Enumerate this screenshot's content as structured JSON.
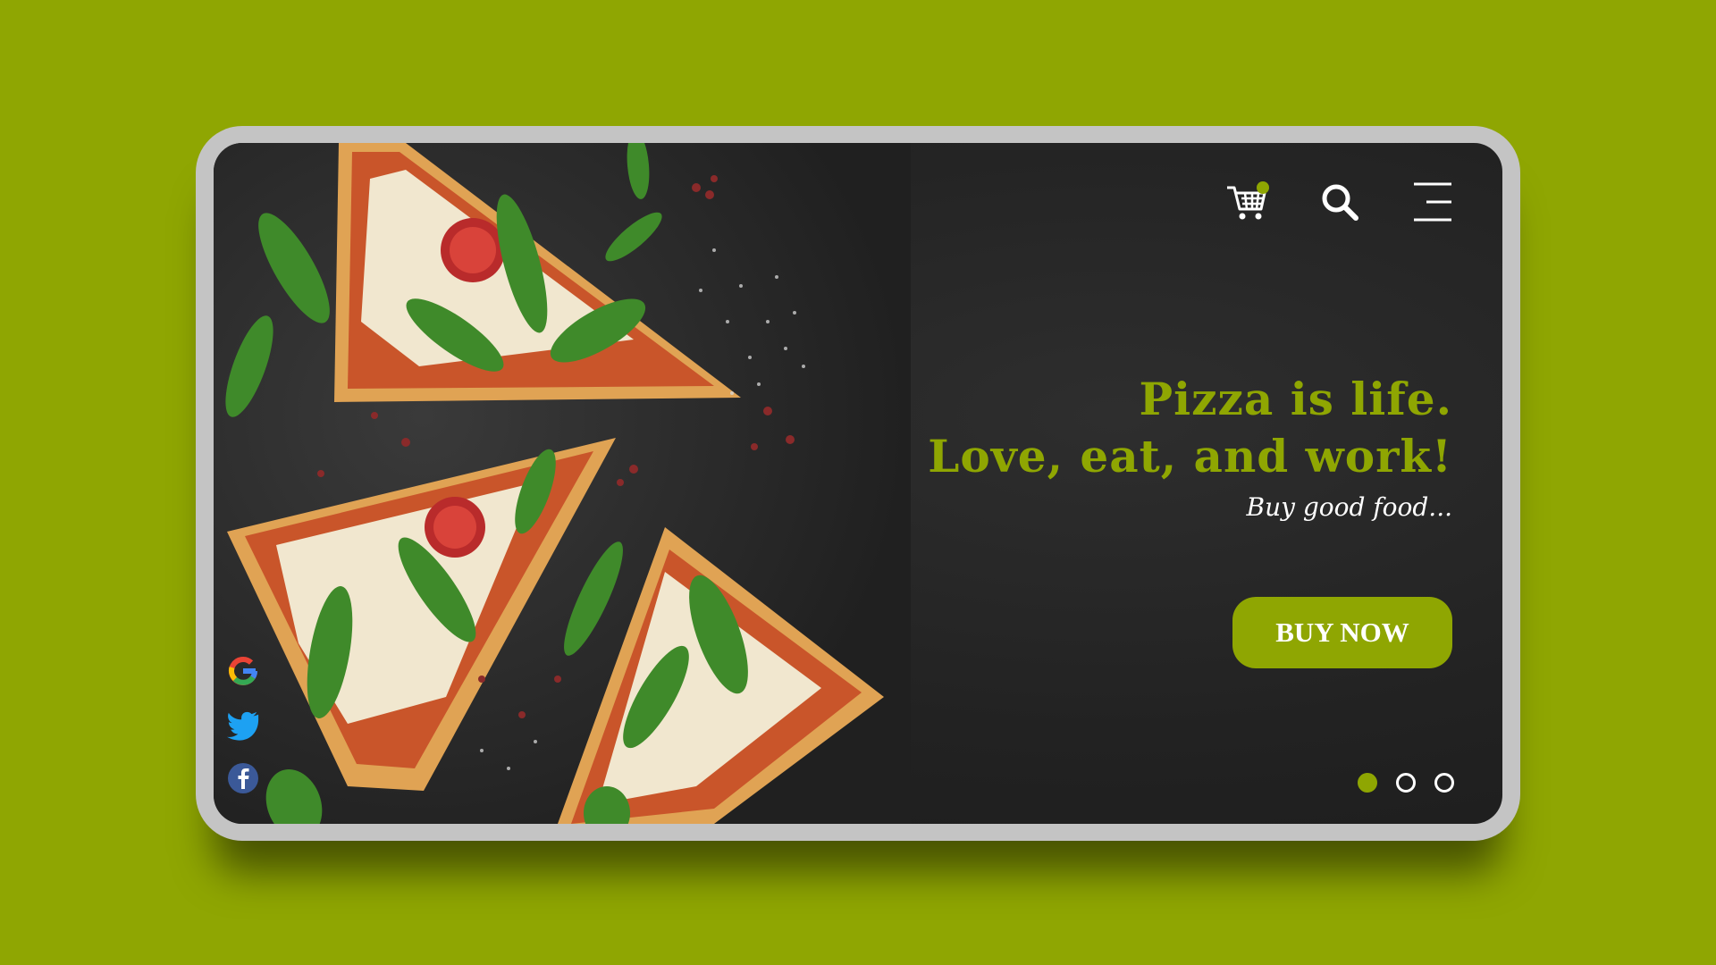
{
  "colors": {
    "accent": "#8fa602",
    "background": "#8fa602",
    "screen": "#222222",
    "frame": "#c4c4c4",
    "text_light": "#ffffff"
  },
  "nav": {
    "icons": [
      "cart-icon",
      "search-icon",
      "menu-icon"
    ]
  },
  "hero": {
    "title_line1": "Pizza is life.",
    "title_line2": "Love, eat, and work!",
    "subtitle": "Buy good food..."
  },
  "cta": {
    "label": "BUY NOW"
  },
  "social": {
    "icons": [
      "google-icon",
      "twitter-icon",
      "facebook-icon"
    ]
  },
  "carousel": {
    "total": 3,
    "active_index": 0
  }
}
